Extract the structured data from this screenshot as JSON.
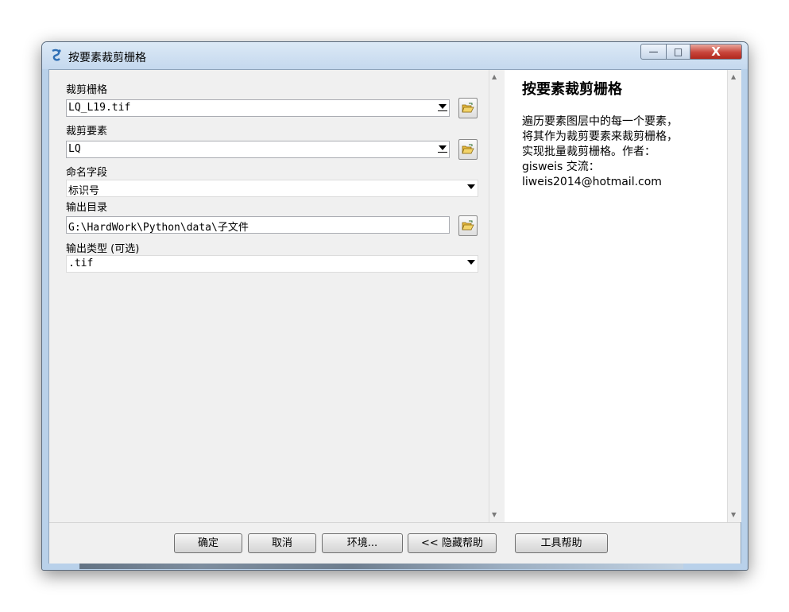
{
  "window": {
    "title": "按要素裁剪栅格",
    "controls": {
      "minimize": "—",
      "maximize": "□",
      "close": "X"
    }
  },
  "form": {
    "fields": [
      {
        "label": "裁剪栅格",
        "value": "LQ_L19.tif"
      },
      {
        "label": "裁剪要素",
        "value": "LQ"
      },
      {
        "label": "命名字段",
        "value": "标识号"
      },
      {
        "label": "输出目录",
        "value": "G:\\HardWork\\Python\\data\\子文件"
      },
      {
        "label": "输出类型 (可选)",
        "value": ".tif"
      }
    ]
  },
  "help": {
    "title": "按要素裁剪栅格",
    "lines": [
      "遍历要素图层中的每一个要素，",
      "将其作为裁剪要素来裁剪栅格，",
      "实现批量裁剪栅格。作者：",
      "gisweis 交流：",
      "liweis2014@hotmail.com"
    ]
  },
  "buttons": {
    "ok": "确定",
    "cancel": "取消",
    "environments": "环境...",
    "hide_help": "<< 隐藏帮助",
    "tool_help": "工具帮助"
  },
  "icons": {
    "app": "python-script-icon",
    "browse": "open-folder-icon"
  },
  "colors": {
    "titlebar": "#c4d8ee",
    "close_button": "#c8453b",
    "panel": "#f0f0f0",
    "folder": "#e7b93c"
  }
}
